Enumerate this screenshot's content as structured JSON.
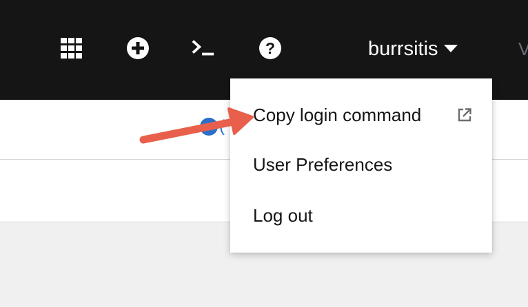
{
  "masthead": {
    "background": "#151515",
    "icons": [
      "app-grid-icon",
      "plus-circle-icon",
      "terminal-icon",
      "help-icon"
    ],
    "username": "burrsitis",
    "edge_text": "V"
  },
  "content": {
    "partial_link_text": "("
  },
  "user_menu": {
    "items": [
      {
        "label": "Copy login command",
        "icon": "external-link-icon"
      },
      {
        "label": "User Preferences"
      },
      {
        "label": "Log out"
      }
    ]
  },
  "annotation": {
    "arrow_color": "#e8604c"
  }
}
